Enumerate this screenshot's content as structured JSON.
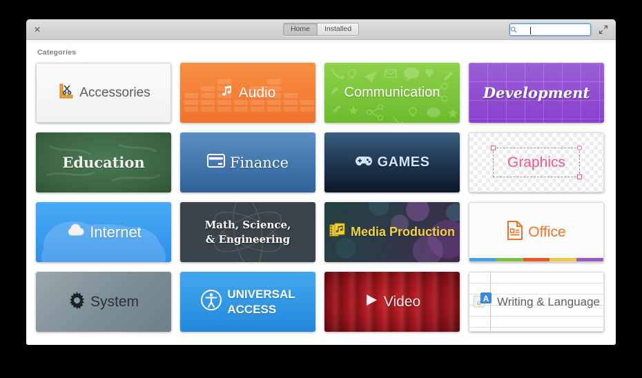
{
  "window": {
    "close_label": "✕",
    "tabs": [
      {
        "label": "Home",
        "active": true
      },
      {
        "label": "Installed",
        "active": false
      }
    ],
    "search": {
      "value": "",
      "placeholder": "",
      "icon": "search-icon"
    },
    "expand_icon": "expand-arrows-icon"
  },
  "content": {
    "section_label": "Categories",
    "tiles": [
      {
        "name": "accessories",
        "label": "Accessories",
        "icon": "ruler-scissors-icon",
        "color": "#f2f2f2"
      },
      {
        "name": "audio",
        "label": "Audio",
        "icon": "music-note-icon",
        "color": "#f0712a"
      },
      {
        "name": "communication",
        "label": "Communication",
        "icon": "none",
        "color": "#6cbb2c"
      },
      {
        "name": "development",
        "label": "Development",
        "icon": "none",
        "color": "#8a3fcf"
      },
      {
        "name": "education",
        "label": "Education",
        "icon": "none",
        "color": "#39613f"
      },
      {
        "name": "finance",
        "label": "Finance",
        "icon": "credit-card-icon",
        "color": "#2f6198"
      },
      {
        "name": "games",
        "label": "GAMES",
        "icon": "gamepad-icon",
        "color": "#1d3450"
      },
      {
        "name": "graphics",
        "label": "Graphics",
        "icon": "none",
        "color": "#f4548f"
      },
      {
        "name": "internet",
        "label": "Internet",
        "icon": "cloud-icon",
        "color": "#2e8fe8"
      },
      {
        "name": "math-science-engineering",
        "label": "Math, Science,\n& Engineering",
        "icon": "none",
        "color": "#3a444a"
      },
      {
        "name": "media-production",
        "label": "Media Production",
        "icon": "film-music-icon",
        "color": "#f2d23f"
      },
      {
        "name": "office",
        "label": "Office",
        "icon": "document-icon",
        "color": "#ef7228"
      },
      {
        "name": "system",
        "label": "System",
        "icon": "gear-icon",
        "color": "#7c8d96"
      },
      {
        "name": "universal-access",
        "label": "UNIVERSAL\nACCESS",
        "icon": "accessibility-icon",
        "color": "#2488db"
      },
      {
        "name": "video",
        "label": "Video",
        "icon": "play-icon",
        "color": "#9c151c"
      },
      {
        "name": "writing-language",
        "label": "Writing & Language",
        "icon": "font-a-icon",
        "color": "#3b87d8"
      }
    ]
  }
}
